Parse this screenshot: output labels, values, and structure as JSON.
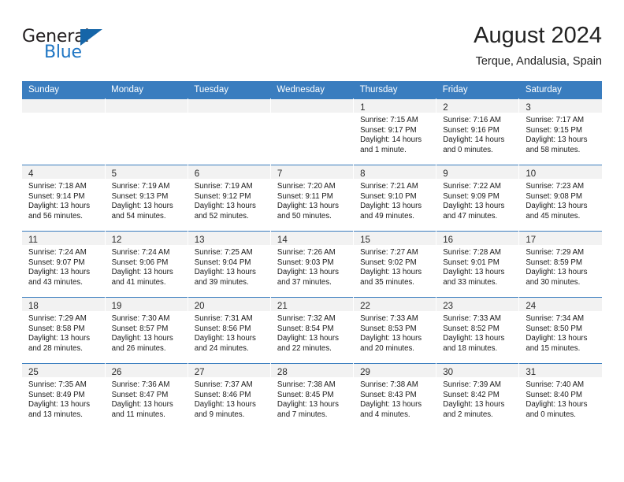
{
  "brand": {
    "name_top": "General",
    "name_bottom": "Blue",
    "accent_color": "#1f76c4",
    "triangle_color": "#1565a8"
  },
  "header": {
    "month_title": "August 2024",
    "location": "Terque, Andalusia, Spain"
  },
  "theme": {
    "header_row_bg": "#3a7dbf",
    "header_row_text": "#ffffff",
    "daynum_strip_bg": "#f2f2f2",
    "cell_bg": "#ffffff",
    "row_divider": "#3a7dbf"
  },
  "weekday_headers": [
    "Sunday",
    "Monday",
    "Tuesday",
    "Wednesday",
    "Thursday",
    "Friday",
    "Saturday"
  ],
  "weeks": [
    [
      {
        "day": ""
      },
      {
        "day": ""
      },
      {
        "day": ""
      },
      {
        "day": ""
      },
      {
        "day": "1",
        "sunrise": "Sunrise: 7:15 AM",
        "sunset": "Sunset: 9:17 PM",
        "daylight_1": "Daylight: 14 hours",
        "daylight_2": "and 1 minute."
      },
      {
        "day": "2",
        "sunrise": "Sunrise: 7:16 AM",
        "sunset": "Sunset: 9:16 PM",
        "daylight_1": "Daylight: 14 hours",
        "daylight_2": "and 0 minutes."
      },
      {
        "day": "3",
        "sunrise": "Sunrise: 7:17 AM",
        "sunset": "Sunset: 9:15 PM",
        "daylight_1": "Daylight: 13 hours",
        "daylight_2": "and 58 minutes."
      }
    ],
    [
      {
        "day": "4",
        "sunrise": "Sunrise: 7:18 AM",
        "sunset": "Sunset: 9:14 PM",
        "daylight_1": "Daylight: 13 hours",
        "daylight_2": "and 56 minutes."
      },
      {
        "day": "5",
        "sunrise": "Sunrise: 7:19 AM",
        "sunset": "Sunset: 9:13 PM",
        "daylight_1": "Daylight: 13 hours",
        "daylight_2": "and 54 minutes."
      },
      {
        "day": "6",
        "sunrise": "Sunrise: 7:19 AM",
        "sunset": "Sunset: 9:12 PM",
        "daylight_1": "Daylight: 13 hours",
        "daylight_2": "and 52 minutes."
      },
      {
        "day": "7",
        "sunrise": "Sunrise: 7:20 AM",
        "sunset": "Sunset: 9:11 PM",
        "daylight_1": "Daylight: 13 hours",
        "daylight_2": "and 50 minutes."
      },
      {
        "day": "8",
        "sunrise": "Sunrise: 7:21 AM",
        "sunset": "Sunset: 9:10 PM",
        "daylight_1": "Daylight: 13 hours",
        "daylight_2": "and 49 minutes."
      },
      {
        "day": "9",
        "sunrise": "Sunrise: 7:22 AM",
        "sunset": "Sunset: 9:09 PM",
        "daylight_1": "Daylight: 13 hours",
        "daylight_2": "and 47 minutes."
      },
      {
        "day": "10",
        "sunrise": "Sunrise: 7:23 AM",
        "sunset": "Sunset: 9:08 PM",
        "daylight_1": "Daylight: 13 hours",
        "daylight_2": "and 45 minutes."
      }
    ],
    [
      {
        "day": "11",
        "sunrise": "Sunrise: 7:24 AM",
        "sunset": "Sunset: 9:07 PM",
        "daylight_1": "Daylight: 13 hours",
        "daylight_2": "and 43 minutes."
      },
      {
        "day": "12",
        "sunrise": "Sunrise: 7:24 AM",
        "sunset": "Sunset: 9:06 PM",
        "daylight_1": "Daylight: 13 hours",
        "daylight_2": "and 41 minutes."
      },
      {
        "day": "13",
        "sunrise": "Sunrise: 7:25 AM",
        "sunset": "Sunset: 9:04 PM",
        "daylight_1": "Daylight: 13 hours",
        "daylight_2": "and 39 minutes."
      },
      {
        "day": "14",
        "sunrise": "Sunrise: 7:26 AM",
        "sunset": "Sunset: 9:03 PM",
        "daylight_1": "Daylight: 13 hours",
        "daylight_2": "and 37 minutes."
      },
      {
        "day": "15",
        "sunrise": "Sunrise: 7:27 AM",
        "sunset": "Sunset: 9:02 PM",
        "daylight_1": "Daylight: 13 hours",
        "daylight_2": "and 35 minutes."
      },
      {
        "day": "16",
        "sunrise": "Sunrise: 7:28 AM",
        "sunset": "Sunset: 9:01 PM",
        "daylight_1": "Daylight: 13 hours",
        "daylight_2": "and 33 minutes."
      },
      {
        "day": "17",
        "sunrise": "Sunrise: 7:29 AM",
        "sunset": "Sunset: 8:59 PM",
        "daylight_1": "Daylight: 13 hours",
        "daylight_2": "and 30 minutes."
      }
    ],
    [
      {
        "day": "18",
        "sunrise": "Sunrise: 7:29 AM",
        "sunset": "Sunset: 8:58 PM",
        "daylight_1": "Daylight: 13 hours",
        "daylight_2": "and 28 minutes."
      },
      {
        "day": "19",
        "sunrise": "Sunrise: 7:30 AM",
        "sunset": "Sunset: 8:57 PM",
        "daylight_1": "Daylight: 13 hours",
        "daylight_2": "and 26 minutes."
      },
      {
        "day": "20",
        "sunrise": "Sunrise: 7:31 AM",
        "sunset": "Sunset: 8:56 PM",
        "daylight_1": "Daylight: 13 hours",
        "daylight_2": "and 24 minutes."
      },
      {
        "day": "21",
        "sunrise": "Sunrise: 7:32 AM",
        "sunset": "Sunset: 8:54 PM",
        "daylight_1": "Daylight: 13 hours",
        "daylight_2": "and 22 minutes."
      },
      {
        "day": "22",
        "sunrise": "Sunrise: 7:33 AM",
        "sunset": "Sunset: 8:53 PM",
        "daylight_1": "Daylight: 13 hours",
        "daylight_2": "and 20 minutes."
      },
      {
        "day": "23",
        "sunrise": "Sunrise: 7:33 AM",
        "sunset": "Sunset: 8:52 PM",
        "daylight_1": "Daylight: 13 hours",
        "daylight_2": "and 18 minutes."
      },
      {
        "day": "24",
        "sunrise": "Sunrise: 7:34 AM",
        "sunset": "Sunset: 8:50 PM",
        "daylight_1": "Daylight: 13 hours",
        "daylight_2": "and 15 minutes."
      }
    ],
    [
      {
        "day": "25",
        "sunrise": "Sunrise: 7:35 AM",
        "sunset": "Sunset: 8:49 PM",
        "daylight_1": "Daylight: 13 hours",
        "daylight_2": "and 13 minutes."
      },
      {
        "day": "26",
        "sunrise": "Sunrise: 7:36 AM",
        "sunset": "Sunset: 8:47 PM",
        "daylight_1": "Daylight: 13 hours",
        "daylight_2": "and 11 minutes."
      },
      {
        "day": "27",
        "sunrise": "Sunrise: 7:37 AM",
        "sunset": "Sunset: 8:46 PM",
        "daylight_1": "Daylight: 13 hours",
        "daylight_2": "and 9 minutes."
      },
      {
        "day": "28",
        "sunrise": "Sunrise: 7:38 AM",
        "sunset": "Sunset: 8:45 PM",
        "daylight_1": "Daylight: 13 hours",
        "daylight_2": "and 7 minutes."
      },
      {
        "day": "29",
        "sunrise": "Sunrise: 7:38 AM",
        "sunset": "Sunset: 8:43 PM",
        "daylight_1": "Daylight: 13 hours",
        "daylight_2": "and 4 minutes."
      },
      {
        "day": "30",
        "sunrise": "Sunrise: 7:39 AM",
        "sunset": "Sunset: 8:42 PM",
        "daylight_1": "Daylight: 13 hours",
        "daylight_2": "and 2 minutes."
      },
      {
        "day": "31",
        "sunrise": "Sunrise: 7:40 AM",
        "sunset": "Sunset: 8:40 PM",
        "daylight_1": "Daylight: 13 hours",
        "daylight_2": "and 0 minutes."
      }
    ]
  ]
}
